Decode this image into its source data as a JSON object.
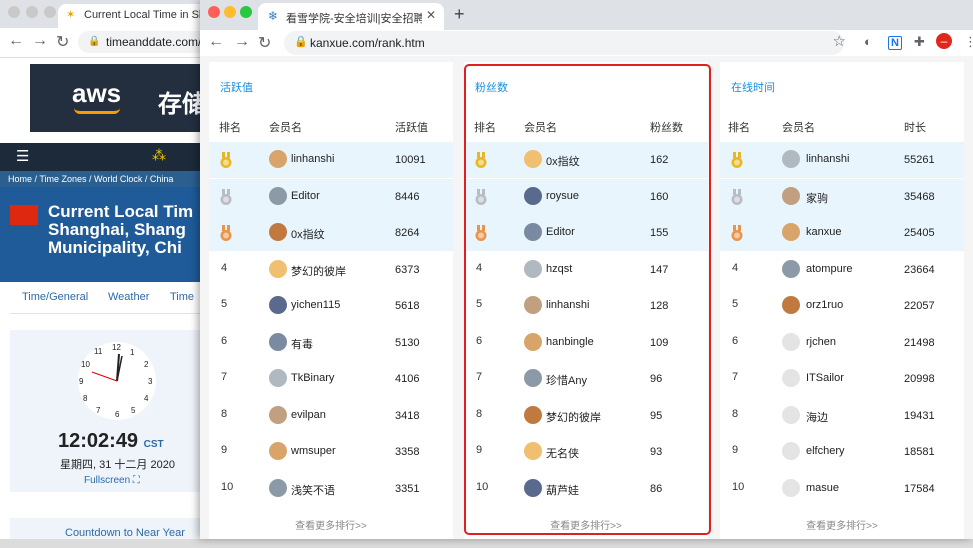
{
  "bg_window": {
    "tab_title": "Current Local Time in Sha",
    "url": "timeanddate.com/",
    "ad_brand": "aws",
    "ad_text": "存储",
    "breadcrumb": "Home /  Time Zones /  World Clock /  China",
    "hero_title": "Current Local Tim Shanghai, Shang Municipality, Chi",
    "tabs": [
      "Time/General",
      "Weather",
      "Time"
    ],
    "clock_numbers": [
      "12",
      "1",
      "2",
      "3",
      "4",
      "5",
      "6",
      "7",
      "8",
      "9",
      "10",
      "11"
    ],
    "time": "12:02:49",
    "tz": "CST",
    "date": "星期四, 31 十二月 2020",
    "fullscreen": "Fullscreen ⛶",
    "countdown": "Countdown to Near Year"
  },
  "browser": {
    "tab_title": "看雪学院-安全培训|安全招聘|w",
    "url": "kanxue.com/rank.htm"
  },
  "colors": {
    "accent": "#1a8fe0",
    "highlight_row": "#e8f5fd",
    "red_box": "#e02020"
  },
  "panels": [
    {
      "title": "活跃值",
      "headers": [
        "排名",
        "会员名",
        "活跃值"
      ],
      "rows": [
        {
          "rank": "1",
          "name": "linhanshi",
          "value": "10091"
        },
        {
          "rank": "2",
          "name": "Editor",
          "value": "8446"
        },
        {
          "rank": "3",
          "name": "0x指纹",
          "value": "8264"
        },
        {
          "rank": "4",
          "name": "梦幻的彼岸",
          "value": "6373"
        },
        {
          "rank": "5",
          "name": "yichen115",
          "value": "5618"
        },
        {
          "rank": "6",
          "name": "有毒",
          "value": "5130"
        },
        {
          "rank": "7",
          "name": "TkBinary",
          "value": "4106"
        },
        {
          "rank": "8",
          "name": "evilpan",
          "value": "3418"
        },
        {
          "rank": "9",
          "name": "wmsuper",
          "value": "3358"
        },
        {
          "rank": "10",
          "name": "浅笑不语",
          "value": "3351"
        }
      ],
      "more": "查看更多排行>>"
    },
    {
      "title": "粉丝数",
      "headers": [
        "排名",
        "会员名",
        "粉丝数"
      ],
      "rows": [
        {
          "rank": "1",
          "name": "0x指纹",
          "value": "162"
        },
        {
          "rank": "2",
          "name": "roysue",
          "value": "160"
        },
        {
          "rank": "3",
          "name": "Editor",
          "value": "155"
        },
        {
          "rank": "4",
          "name": "hzqst",
          "value": "147"
        },
        {
          "rank": "5",
          "name": "linhanshi",
          "value": "128"
        },
        {
          "rank": "6",
          "name": "hanbingle",
          "value": "109"
        },
        {
          "rank": "7",
          "name": "珍惜Any",
          "value": "96"
        },
        {
          "rank": "8",
          "name": "梦幻的彼岸",
          "value": "95"
        },
        {
          "rank": "9",
          "name": "无名侠",
          "value": "93"
        },
        {
          "rank": "10",
          "name": "葫芦娃",
          "value": "86"
        }
      ],
      "more": "查看更多排行>>"
    },
    {
      "title": "在线时间",
      "headers": [
        "排名",
        "会员名",
        "时长"
      ],
      "rows": [
        {
          "rank": "1",
          "name": "linhanshi",
          "value": "55261"
        },
        {
          "rank": "2",
          "name": "家驹",
          "value": "35468"
        },
        {
          "rank": "3",
          "name": "kanxue",
          "value": "25405"
        },
        {
          "rank": "4",
          "name": "atompure",
          "value": "23664"
        },
        {
          "rank": "5",
          "name": "orz1ruo",
          "value": "22057"
        },
        {
          "rank": "6",
          "name": "rjchen",
          "value": "21498"
        },
        {
          "rank": "7",
          "name": "ITSailor",
          "value": "20998"
        },
        {
          "rank": "8",
          "name": "海边",
          "value": "19431"
        },
        {
          "rank": "9",
          "name": "elfchery",
          "value": "18581"
        },
        {
          "rank": "10",
          "name": "masue",
          "value": "17584"
        }
      ],
      "more": "查看更多排行>>"
    }
  ]
}
